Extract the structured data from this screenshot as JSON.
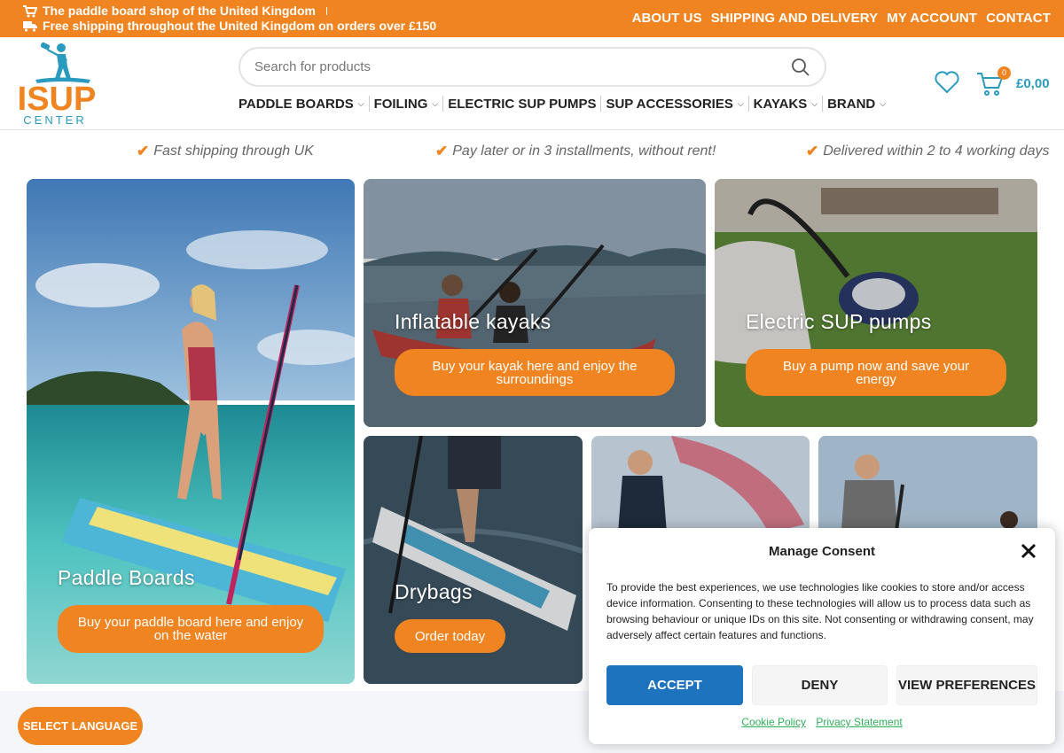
{
  "topbar": {
    "promo_line_1": "The paddle board shop of the United Kingdom",
    "promo_line_2": "Free shipping throughout the United Kingdom on orders over £150",
    "links": [
      "ABOUT US",
      "SHIPPING AND DELIVERY",
      "MY ACCOUNT",
      "CONTACT"
    ]
  },
  "header": {
    "logo_text": "ISUP",
    "logo_subtext": "CENTER",
    "search_placeholder": "Search for products",
    "nav": [
      "PADDLE BOARDS",
      "FOILING",
      "ELECTRIC SUP PUMPS",
      "SUP ACCESSORIES",
      "KAYAKS",
      "BRAND"
    ],
    "cart_count": "0",
    "cart_total": "£0,00"
  },
  "usps": [
    "Fast shipping through UK",
    "Pay later or in 3 installments, without rent!",
    "Delivered within 2 to 4 working days"
  ],
  "tiles": {
    "paddle_boards": {
      "title": "Paddle Boards",
      "button": "Buy your paddle board here and enjoy on the water"
    },
    "kayaks": {
      "title": "Inflatable kayaks",
      "button": "Buy your kayak here and enjoy the surroundings"
    },
    "pumps": {
      "title": "Electric SUP pumps",
      "button": "Buy a pump now and save your energy"
    },
    "drybags": {
      "title": "Drybags",
      "button": "Order today"
    }
  },
  "language_button": "SELECT LANGUAGE",
  "consent": {
    "title": "Manage Consent",
    "body": "To provide the best experiences, we use technologies like cookies to store and/or access device information. Consenting to these technologies will allow us to process data such as browsing behaviour or unique IDs on this site. Not consenting or withdrawing consent, may adversely affect certain features and functions.",
    "accept": "ACCEPT",
    "deny": "DENY",
    "preferences": "VIEW PREFERENCES",
    "cookie_policy": "Cookie Policy",
    "privacy_statement": "Privacy Statement"
  },
  "colors": {
    "brand_orange": "#EF8421",
    "brand_teal": "#2A9BBF",
    "accept_blue": "#1E73BE",
    "link_green": "#2FB05A"
  }
}
